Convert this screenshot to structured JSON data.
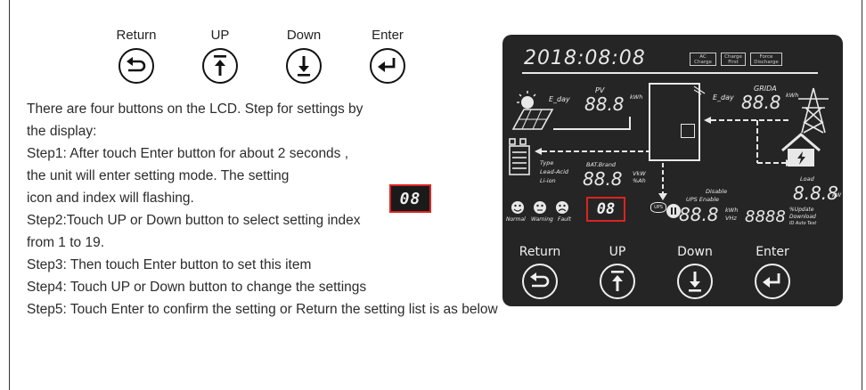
{
  "buttons": [
    {
      "label": "Return",
      "icon": "return-arrow-icon"
    },
    {
      "label": "UP",
      "icon": "up-arrow-icon"
    },
    {
      "label": "Down",
      "icon": "down-arrow-icon"
    },
    {
      "label": "Enter",
      "icon": "enter-arrow-icon"
    }
  ],
  "instructions": {
    "line1": "There are four buttons on the LCD. Step for settings by",
    "line2": "the display:",
    "line3": "Step1: After touch Enter button for about 2  seconds ,",
    "line4": "the unit will enter setting mode. The setting",
    "line5": "icon and index will flashing.",
    "line6": "Step2:Touch UP or Down button to select setting index",
    "line7": "from 1 to 19.",
    "line8": "Step3: Then touch Enter button to set this item",
    "line9": "Step4: Touch UP or Down button to change the settings",
    "line10": "Step5: Touch Enter to confirm the setting or Return the setting list is as below",
    "setting_icon_value": "08"
  },
  "lcd": {
    "datetime": "2018:08:08",
    "modes": [
      "AC Charge",
      "Charge First",
      "Force Discharge"
    ],
    "pv_label": "PV",
    "pv_value": "88.8",
    "pv_unit": "kWh",
    "pv_eday": "E_day",
    "grid_label": "GRIDA",
    "grid_eday": "E_day",
    "grid_value": "88.8",
    "grid_unit": "kWh",
    "bat_type": "Type",
    "bat_type_lead": "Lead-Acid",
    "bat_type_li": "Li-ion",
    "bat_brand": "BAT.Brand",
    "bat_value": "88.8",
    "bat_unit1": "VkW",
    "bat_unit2": "%Ah",
    "setting_index": "08",
    "status_normal": "Normal",
    "status_warning": "Warning",
    "status_fault": "Fault",
    "ups_badge": "UPS",
    "ups_disable": "Disable",
    "ups_enable": "UPS Enable",
    "ups_value": "88.8",
    "ups_unit1": "kWh",
    "ups_unit2": "VHz",
    "load_label": "Load",
    "load_value": "8.8.8",
    "load_unit": "kW",
    "update_value": "8888",
    "update_unit1": "%Update",
    "update_unit2": "Download",
    "update_unit3": "ID Auto Test",
    "btn_labels": [
      "Return",
      "UP",
      "Down",
      "Enter"
    ]
  },
  "colors": {
    "lcd_bg": "#252525",
    "highlight": "#d22222"
  }
}
